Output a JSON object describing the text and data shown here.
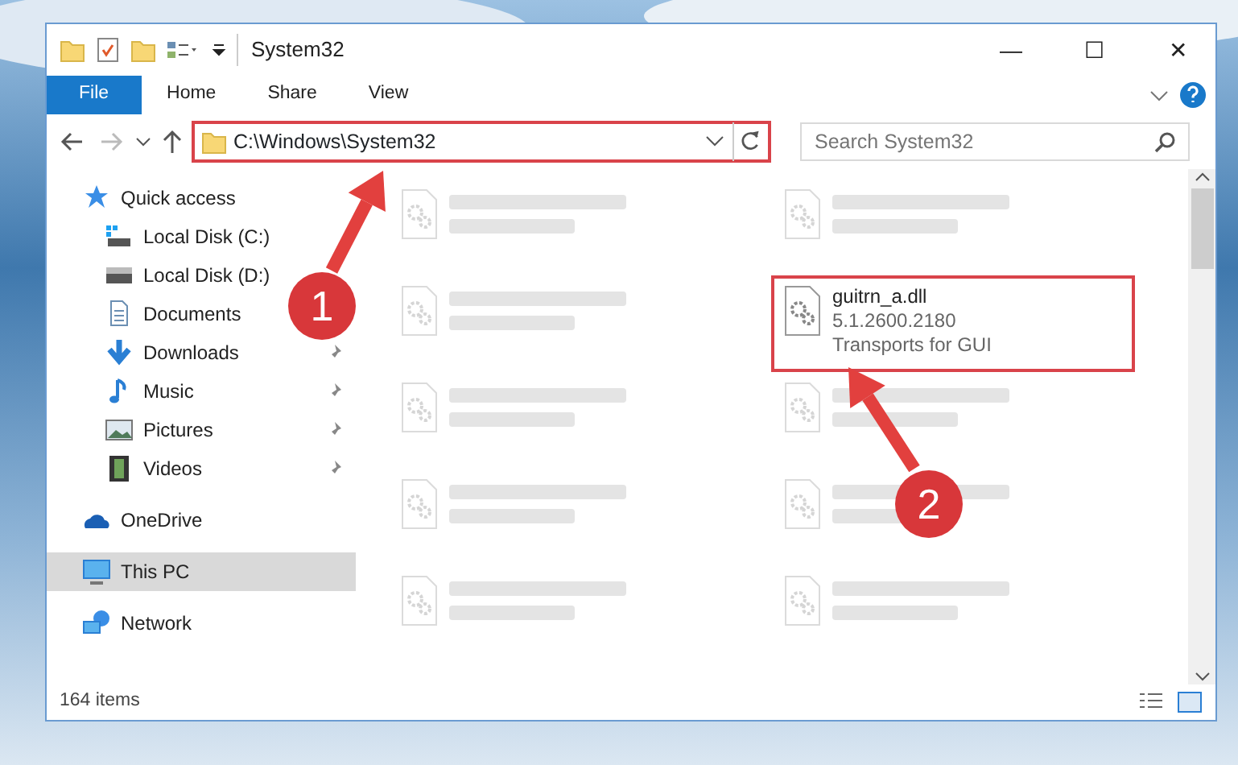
{
  "window": {
    "title": "System32",
    "controls": [
      "—",
      "☐",
      "✕"
    ]
  },
  "ribbon": {
    "tabs": [
      {
        "label": "File",
        "selected": true
      },
      {
        "label": "Home",
        "selected": false
      },
      {
        "label": "Share",
        "selected": false
      },
      {
        "label": "View",
        "selected": false
      }
    ]
  },
  "address_bar": {
    "path": "C:\\Windows\\System32",
    "highlighted": true
  },
  "search": {
    "placeholder": "Search System32"
  },
  "sidebar": {
    "items": [
      {
        "kind": "quick",
        "label": "Quick access",
        "selected": false,
        "pinned": false,
        "children": [
          {
            "kind": "winDisk",
            "label": "Local Disk (C:)",
            "selected": false,
            "pinned": false
          },
          {
            "kind": "disk",
            "label": "Local Disk (D:)",
            "selected": false,
            "pinned": false
          },
          {
            "kind": "documents",
            "label": "Documents",
            "selected": false,
            "pinned": false
          },
          {
            "kind": "downloads",
            "label": "Downloads",
            "selected": false,
            "pinned": true
          },
          {
            "kind": "music",
            "label": "Music",
            "selected": false,
            "pinned": true
          },
          {
            "kind": "pictures",
            "label": "Pictures",
            "selected": false,
            "pinned": true
          },
          {
            "kind": "videos",
            "label": "Videos",
            "selected": false,
            "pinned": true
          }
        ]
      },
      {
        "kind": "onedrive",
        "label": "OneDrive",
        "selected": false,
        "pinned": false
      },
      {
        "kind": "pc",
        "label": "This PC",
        "selected": true,
        "pinned": false
      },
      {
        "kind": "network",
        "label": "Network",
        "selected": false,
        "pinned": false
      }
    ]
  },
  "files": [
    {
      "blurred": true,
      "highlighted": false
    },
    {
      "blurred": true,
      "highlighted": false
    },
    {
      "blurred": true,
      "highlighted": false
    },
    {
      "name": "guitrn_a.dll",
      "lines": [
        "5.1.2600.2180",
        "Transports for GUI"
      ],
      "blurred": false,
      "highlighted": true
    },
    {
      "blurred": true,
      "highlighted": false
    },
    {
      "blurred": true,
      "highlighted": false
    },
    {
      "blurred": true,
      "highlighted": false
    },
    {
      "blurred": true,
      "highlighted": false
    },
    {
      "blurred": true,
      "highlighted": false
    },
    {
      "blurred": true,
      "highlighted": false
    }
  ],
  "annotations": [
    {
      "number": "1"
    },
    {
      "number": "2"
    }
  ],
  "status_bar": {
    "count": "164 items"
  }
}
